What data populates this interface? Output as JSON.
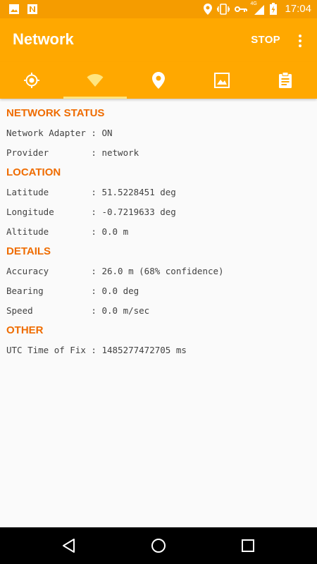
{
  "status_bar": {
    "time": "17:04",
    "network_type": "4G",
    "left_icons": [
      "image-icon",
      "notification-n-icon"
    ],
    "right_icons": [
      "location-pin-icon",
      "vibrate-icon",
      "vpn-key-icon",
      "signal-icon",
      "battery-charging-icon"
    ]
  },
  "app_bar": {
    "title": "Network",
    "stop_label": "STOP"
  },
  "tabs": [
    {
      "icon": "gps-target-icon",
      "active": false
    },
    {
      "icon": "wifi-icon",
      "active": true
    },
    {
      "icon": "map-pin-icon",
      "active": false
    },
    {
      "icon": "image-icon",
      "active": false
    },
    {
      "icon": "clipboard-icon",
      "active": false
    }
  ],
  "sections": {
    "network_status": {
      "title": "NETWORK STATUS",
      "rows": [
        "Network Adapter : ON",
        "Provider        : network"
      ]
    },
    "location": {
      "title": "LOCATION",
      "rows": [
        "Latitude        : 51.5228451 deg",
        "Longitude       : -0.7219633 deg",
        "Altitude        : 0.0 m"
      ]
    },
    "details": {
      "title": "DETAILS",
      "rows": [
        "Accuracy        : 26.0 m (68% confidence)",
        "Bearing         : 0.0 deg",
        "Speed           : 0.0 m/sec"
      ]
    },
    "other": {
      "title": "OTHER",
      "rows": [
        "UTC Time of Fix : 1485277472705 ms"
      ]
    }
  },
  "navigation": [
    "back-icon",
    "home-icon",
    "recents-icon"
  ],
  "colors": {
    "status_bar": "#f59c00",
    "app_bar": "#ffa800",
    "tab_indicator": "#ffe57f",
    "section_title": "#ef6c00",
    "row_text": "#424242",
    "background": "#fafafa"
  }
}
